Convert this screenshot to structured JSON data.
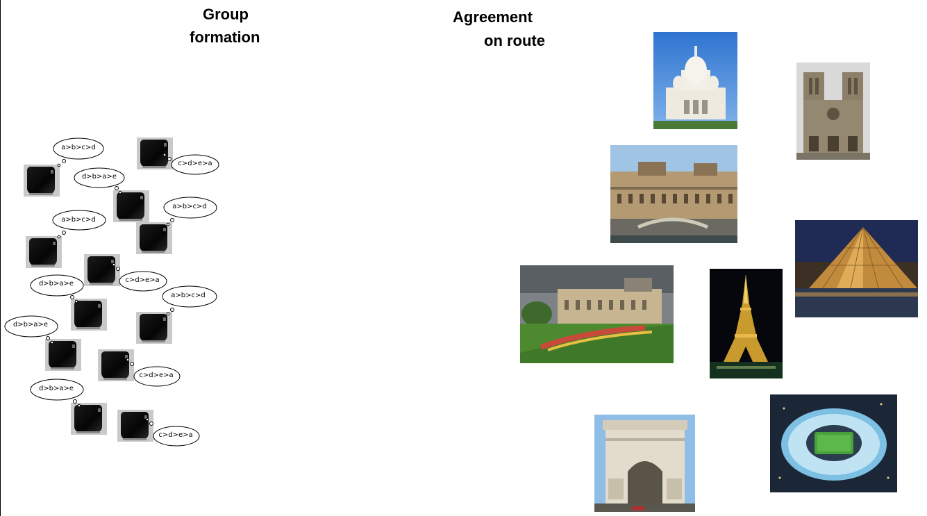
{
  "headings": {
    "group_formation_line1": "Group",
    "group_formation_line2": "formation",
    "agreement_line1": "Agreement",
    "agreement_line2": "on route"
  },
  "bubbles": [
    "a>b>c>d",
    "c>d>e>a",
    "d>b>a>e",
    "a>b>c>d",
    "a>b>c>d",
    "c>d>e>a",
    "d>b>a>e",
    "a>b>c>d",
    "d>b>a>e",
    "c>d>e>a",
    "d>b>a>e",
    "c>d>e>a"
  ],
  "colors": {
    "text": "#000000",
    "robot_body": "#111111",
    "background": "#ffffff"
  },
  "landmarks": [
    "sacre-coeur-photo",
    "notre-dame-photo",
    "musee-orsay-photo",
    "louvre-pyramid-photo",
    "luxembourg-palace-photo",
    "eiffel-tower-photo",
    "arc-de-triomphe-photo",
    "stade-de-france-photo"
  ]
}
